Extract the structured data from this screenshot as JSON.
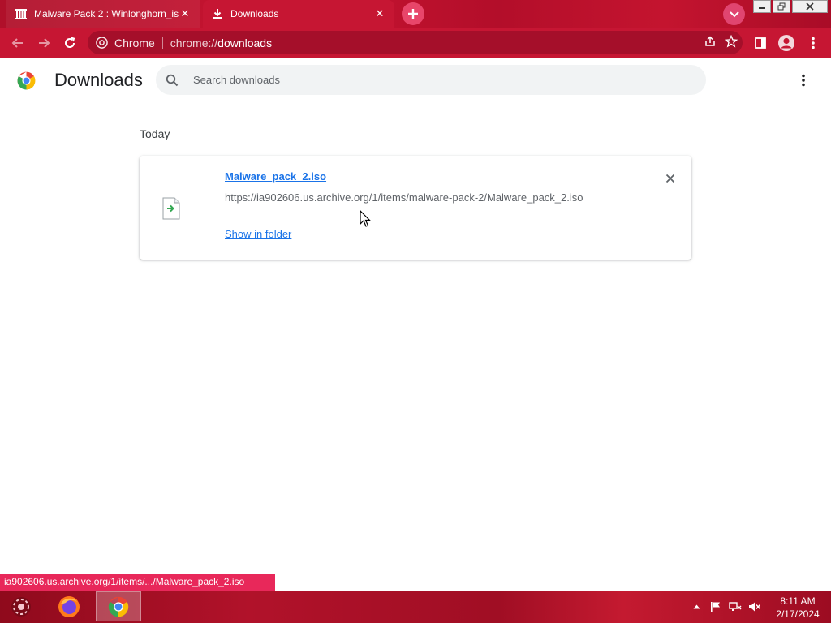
{
  "tabs": [
    {
      "title": "Malware Pack 2 : Winlonghorn_is",
      "close": "✕",
      "icon": "archive-org-icon"
    },
    {
      "title": "Downloads",
      "close": "✕",
      "icon": "download-icon"
    }
  ],
  "toolbar": {
    "origin_label": "Chrome",
    "url_scheme": "chrome://",
    "url_host": "downloads"
  },
  "page": {
    "title": "Downloads",
    "search_placeholder": "Search downloads",
    "section": "Today"
  },
  "downloads": [
    {
      "file_name": "Malware_pack_2.iso",
      "url": "https://ia902606.us.archive.org/1/items/malware-pack-2/Malware_pack_2.iso",
      "action": "Show in folder"
    }
  ],
  "status_bar": {
    "text": "ia902606.us.archive.org/1/items/.../Malware_pack_2.iso"
  },
  "taskbar": {
    "apps": [
      "firefox-icon",
      "chrome-icon"
    ],
    "time": "8:11 AM",
    "date": "2/17/2024"
  },
  "colors": {
    "theme": "#c61633",
    "accent": "#1a73e8",
    "status_bubble": "#e8285a"
  }
}
